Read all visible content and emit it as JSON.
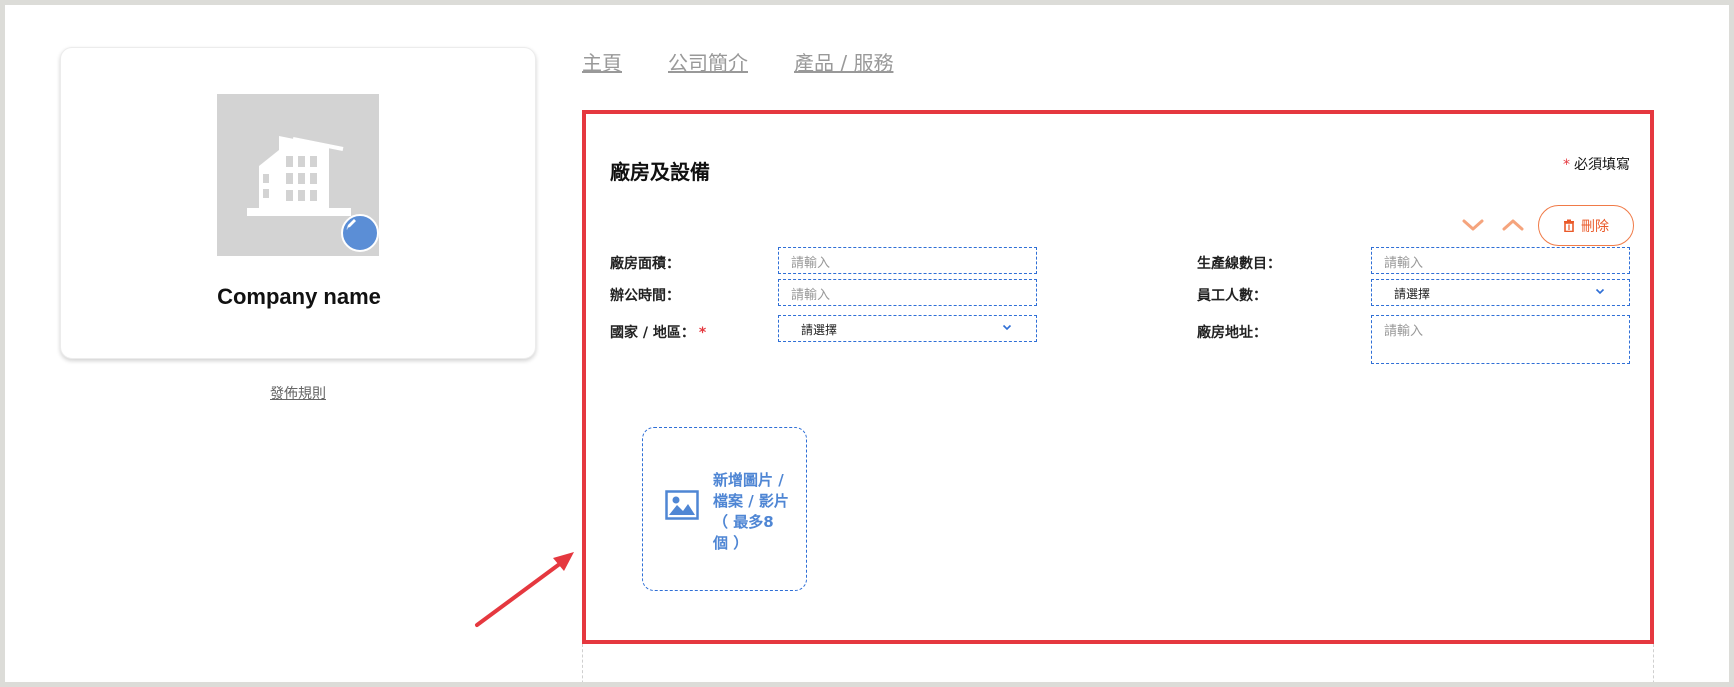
{
  "profile": {
    "company_name": "Company name",
    "logo_icon": "building-placeholder-icon",
    "edit_icon": "pencil-icon"
  },
  "rules_link": "發佈規則",
  "nav": [
    {
      "label": "主頁"
    },
    {
      "label": "公司簡介"
    },
    {
      "label": "產品 / 服務"
    }
  ],
  "panel": {
    "title": "廠房及設備",
    "required_star": "*",
    "required_note": "必須填寫",
    "delete_label": "刪除",
    "colors": {
      "border": "#e5383f",
      "accent": "#f07a47",
      "field_border": "#2f6fd6"
    }
  },
  "form": {
    "factory_area": {
      "label": "廠房面積：",
      "placeholder": "請輸入"
    },
    "office_hours": {
      "label": "辦公時間：",
      "placeholder": "請輸入"
    },
    "country_region": {
      "label": "國家 / 地區：",
      "required_star": "*",
      "value": "請選擇"
    },
    "production_lines": {
      "label": "生產線數目：",
      "placeholder": "請輸入"
    },
    "employees": {
      "label": "員工人數：",
      "value": "請選擇"
    },
    "factory_address": {
      "label": "廠房地址：",
      "placeholder": "請輸入"
    }
  },
  "upload": {
    "line1": "新增圖片 /",
    "line2": "檔案 / 影片",
    "line3": "（ 最多8",
    "line4": "個 ）",
    "icon": "image-icon"
  }
}
